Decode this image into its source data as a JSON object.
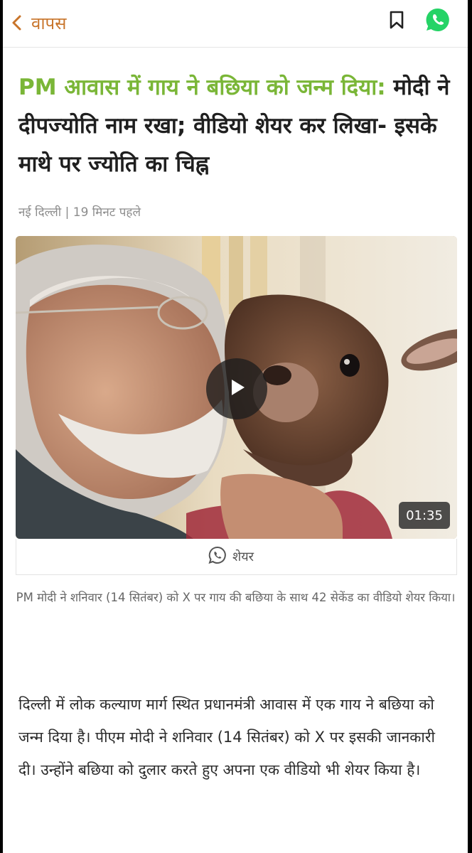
{
  "topbar": {
    "back_label": "वापस",
    "icons": {
      "back": "chevron-left-icon",
      "bookmark": "bookmark-icon",
      "whatsapp": "whatsapp-icon"
    }
  },
  "article": {
    "headline_highlight": "PM आवास में गाय ने बछिया को जन्म दिया:",
    "headline_rest": " मोदी ने दीपज्योति नाम रखा; वीडियो शेयर कर लिखा- इसके माथे पर ज्योति का चिह्न",
    "meta": "नई दिल्ली | 19 मिनट पहले",
    "video": {
      "duration": "01:35",
      "play_icon": "play-icon"
    },
    "share_label": "शेयर",
    "caption": "PM मोदी ने शनिवार (14 सितंबर) को X पर गाय की बछिया के साथ 42 सेकेंड का वीडियो शेयर किया।",
    "body": "दिल्ली में लोक कल्याण मार्ग स्थित प्रधानमंत्री आवास में एक गाय ने बछिया को जन्म दिया है। पीएम मोदी ने शनिवार (14 सितंबर) को X पर इसकी जानकारी दी। उन्होंने बछिया को दुलार करते हुए अपना एक वीडियो भी शेयर किया है।"
  },
  "colors": {
    "accent_green": "#7ab637",
    "back_orange": "#c8742a",
    "whatsapp_green": "#25d366"
  }
}
